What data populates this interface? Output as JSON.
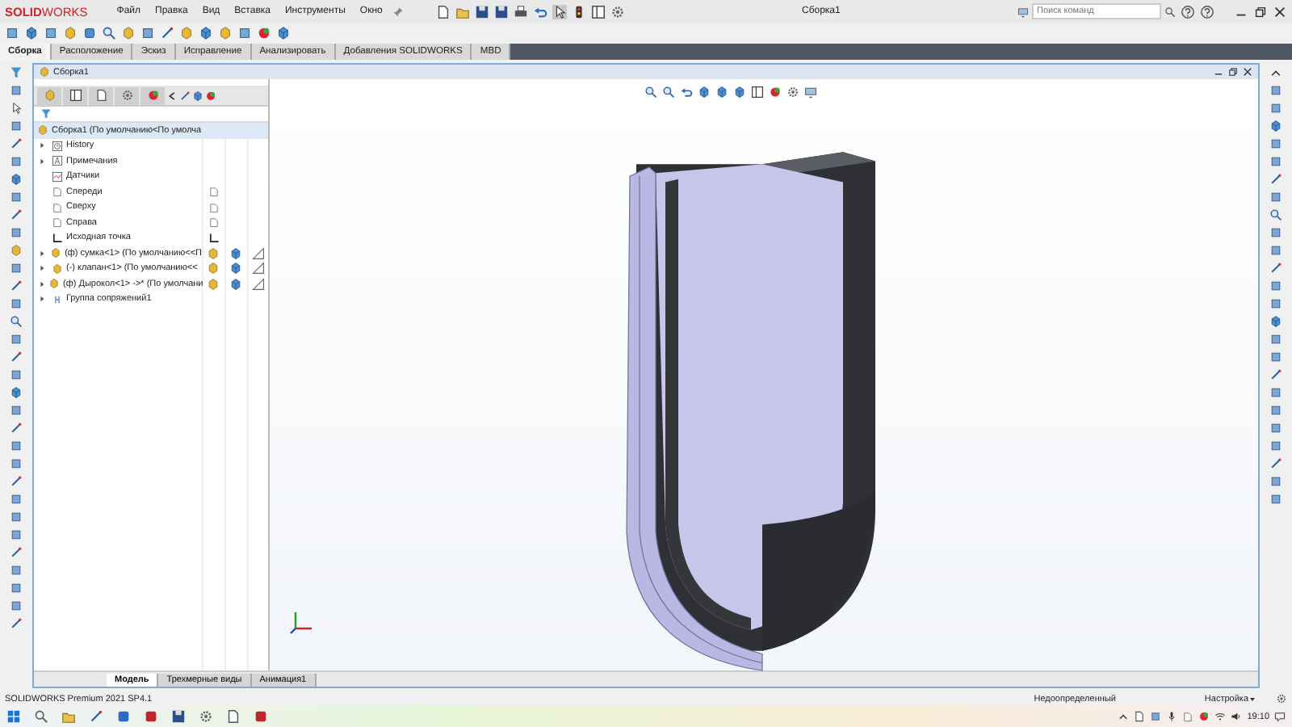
{
  "app": {
    "logo": "**SOLID**WORKS",
    "menu": [
      "Файл",
      "Правка",
      "Вид",
      "Вставка",
      "Инструменты",
      "Окно"
    ],
    "title": "Сборка1",
    "search": {
      "placeholder": "Поиск команд"
    }
  },
  "tabs": [
    {
      "label": "Сборка",
      "selected": true
    },
    {
      "label": "Расположение",
      "selected": false
    },
    {
      "label": "Эскиз",
      "selected": false
    },
    {
      "label": "Исправление",
      "selected": false
    },
    {
      "label": "Анализировать",
      "selected": false
    },
    {
      "label": "Добавления SOLIDWORKS",
      "selected": false
    },
    {
      "label": "MBD",
      "selected": false
    }
  ],
  "document": {
    "title": "Сборка1",
    "tree": {
      "root": "Сборка1  (По умолчанию<По умолча",
      "items": [
        {
          "kind": "history",
          "label": "History",
          "expandable": true
        },
        {
          "kind": "annotations",
          "label": "Примечания",
          "expandable": true
        },
        {
          "kind": "sensors",
          "label": "Датчики",
          "expandable": false
        },
        {
          "kind": "plane",
          "label": "Спереди",
          "expandable": false
        },
        {
          "kind": "plane",
          "label": "Сверху",
          "expandable": false
        },
        {
          "kind": "plane",
          "label": "Справа",
          "expandable": false
        },
        {
          "kind": "origin",
          "label": "Исходная точка",
          "expandable": false
        },
        {
          "kind": "component",
          "label": "(ф) сумка<1> (По умолчанию<<П",
          "expandable": true
        },
        {
          "kind": "component",
          "label": "(-) клапан<1> (По умолчанию<<",
          "expandable": true
        },
        {
          "kind": "component",
          "label": "(ф) Дырокол<1> ->* (По умолчани",
          "expandable": true
        },
        {
          "kind": "mates",
          "label": "Группа сопряжений1",
          "expandable": true
        }
      ]
    },
    "bottom_tabs": [
      {
        "label": "Модель",
        "selected": true
      },
      {
        "label": "Трехмерные виды",
        "selected": false
      },
      {
        "label": "Анимация1",
        "selected": false
      }
    ]
  },
  "status_bar": {
    "product": "SOLIDWORKS Premium 2021 SP4.1",
    "state": "Недоопределенный",
    "settings": "Настройка"
  },
  "taskbar": {
    "time": "19:10"
  }
}
